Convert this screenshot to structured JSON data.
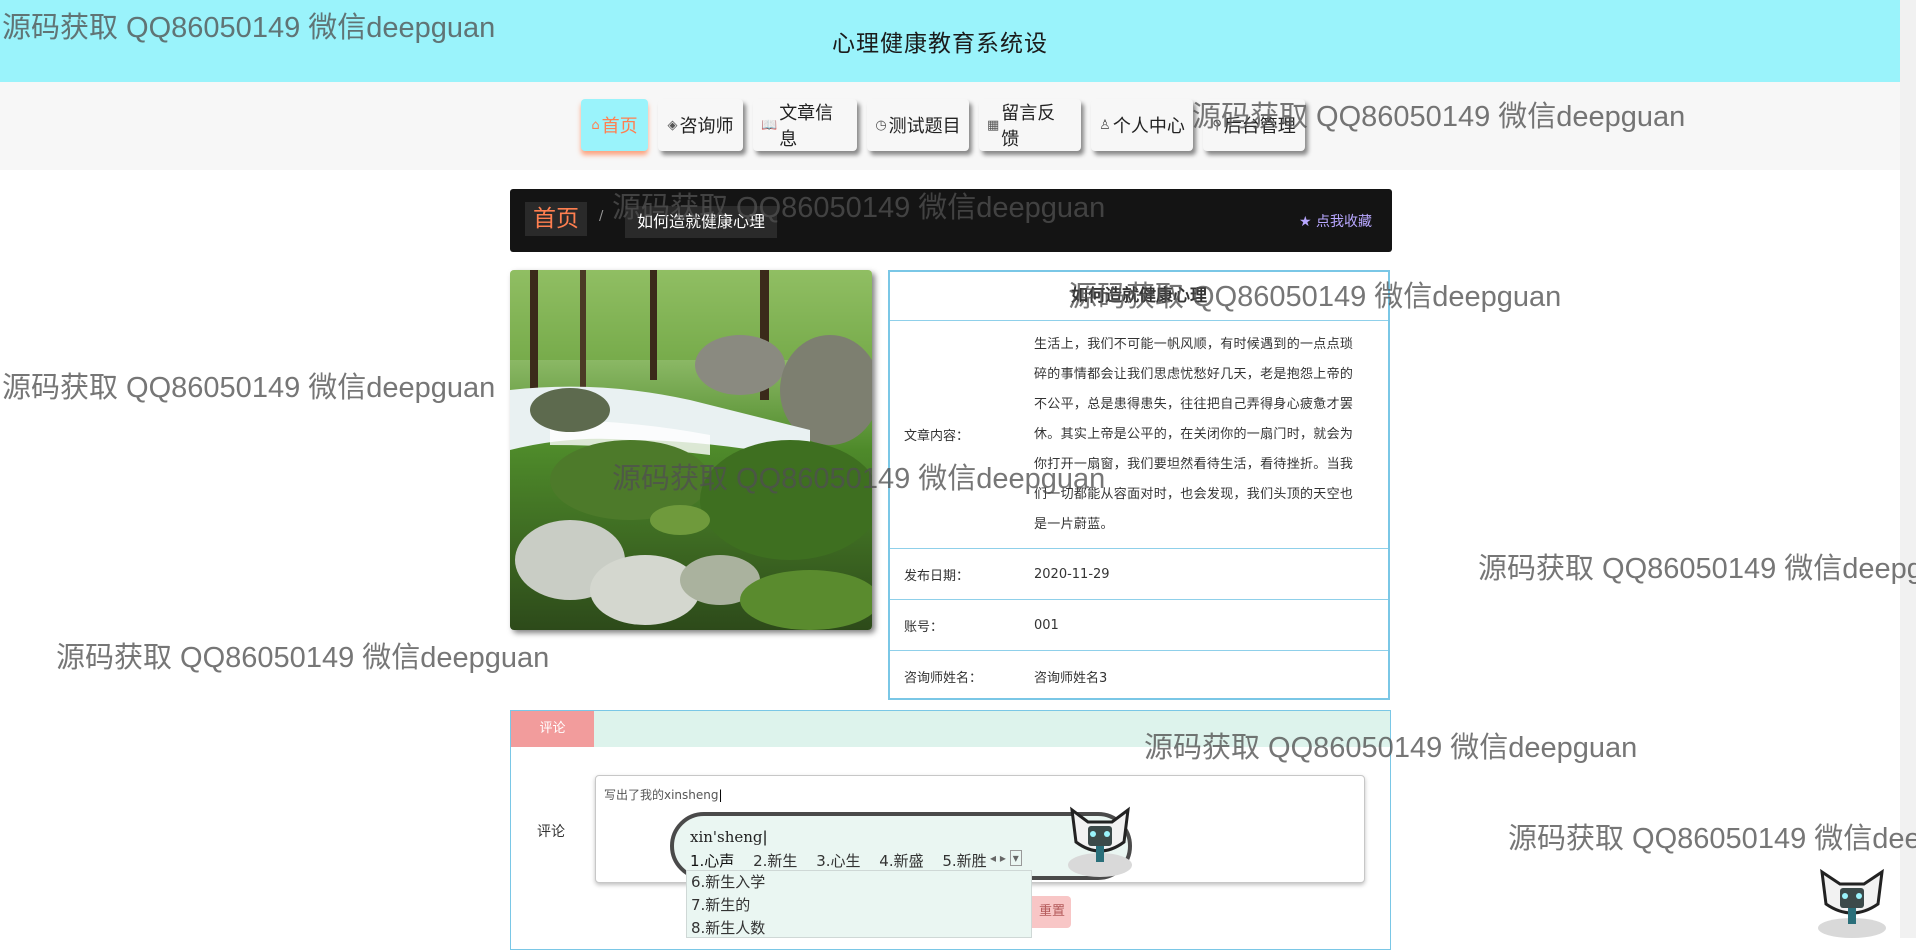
{
  "header": {
    "title": "心理健康教育系统设"
  },
  "nav": {
    "items": [
      {
        "icon": "⌂",
        "label": "首页"
      },
      {
        "icon": "◈",
        "label": "咨询师"
      },
      {
        "icon": "📖",
        "label": "文章信息"
      },
      {
        "icon": "◷",
        "label": "测试题目"
      },
      {
        "icon": "▦",
        "label": "留言反馈"
      },
      {
        "icon": "♙",
        "label": "个人中心"
      },
      {
        "icon": "⚲",
        "label": "后台管理"
      }
    ]
  },
  "breadcrumb": {
    "home": "首页",
    "separator": "/",
    "current": "如何造就健康心理",
    "favorite": "点我收藏"
  },
  "article": {
    "title": "如何造就健康心理",
    "content_label": "文章内容：",
    "content": "生活上，我们不可能一帆风顺，有时候遇到的一点点琐碎的事情都会让我们思虑忧愁好几天，老是抱怨上帝的不公平，总是患得患失，往往把自己弄得身心疲惫才罢休。其实上帝是公平的，在关闭你的一扇门时，就会为你打开一扇窗，我们要坦然看待生活，看待挫折。当我们一切都能从容面对时，也会发现，我们头顶的天空也是一片蔚蓝。",
    "date_label": "发布日期：",
    "date": "2020-11-29",
    "account_label": "账号：",
    "account": "001",
    "counselor_label": "咨询师姓名：",
    "counselor": "咨询师姓名3"
  },
  "comment": {
    "tab": "评论",
    "label": "评论",
    "value": "写出了我的xinsheng",
    "reset": "重置"
  },
  "ime": {
    "pinyin": "xin'sheng",
    "candidates": [
      "1.心声",
      "2.新生",
      "3.心生",
      "4.新盛",
      "5.新胜"
    ],
    "more": [
      "6.新生入学",
      "7.新生的",
      "8.新生人数"
    ]
  },
  "watermark": "源码获取 QQ86050149 微信deepguan"
}
